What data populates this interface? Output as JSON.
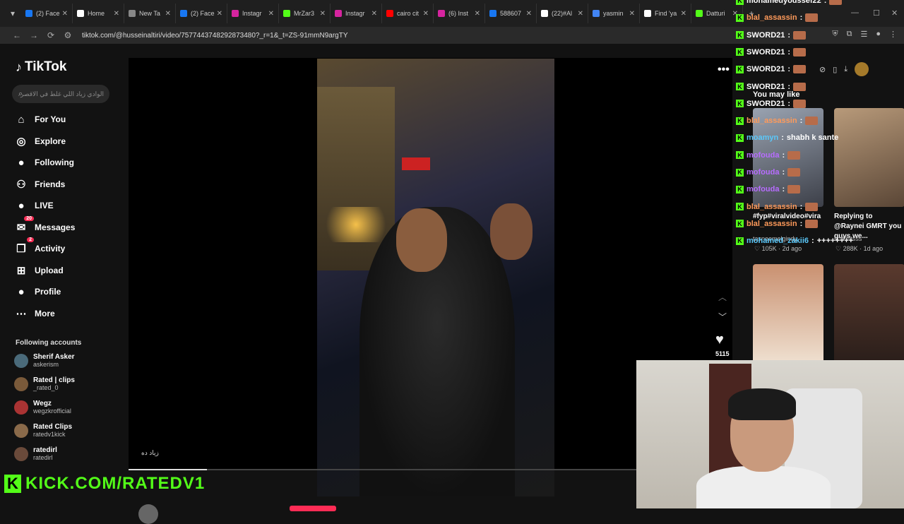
{
  "browser": {
    "tabs": [
      {
        "label": "(2) Face",
        "icon": "facebook-icon",
        "color": "#1877f2"
      },
      {
        "label": "Home",
        "icon": "x-icon",
        "color": "#ffffff"
      },
      {
        "label": "New Ta",
        "icon": "chrome-icon",
        "color": "#888888"
      },
      {
        "label": "(2) Face",
        "icon": "facebook-icon",
        "color": "#1877f2"
      },
      {
        "label": "Instagr",
        "icon": "instagram-icon",
        "color": "#d6249f"
      },
      {
        "label": "MrZar3",
        "icon": "kick-icon",
        "color": "#53fc18"
      },
      {
        "label": "Instagr",
        "icon": "instagram-icon",
        "color": "#d6249f"
      },
      {
        "label": "cairo cit",
        "icon": "youtube-icon",
        "color": "#ff0000"
      },
      {
        "label": "(6) Inst",
        "icon": "instagram-icon",
        "color": "#d6249f"
      },
      {
        "label": "588607",
        "icon": "facebook-icon",
        "color": "#1877f2"
      },
      {
        "label": "(22)#Al",
        "icon": "tiktok-icon",
        "color": "#ffffff"
      },
      {
        "label": "yasmin",
        "icon": "google-icon",
        "color": "#4285f4"
      },
      {
        "label": "Find 'ya",
        "icon": "tiktok-icon",
        "color": "#ffffff"
      },
      {
        "label": "Datturi",
        "icon": "kick-icon",
        "color": "#53fc18"
      }
    ],
    "url": "tiktok.com/@husseinaltiri/video/7577443748292873480?_r=1&_t=ZS-91mmN9argTY"
  },
  "sidebar": {
    "logo": "TikTok",
    "search_placeholder": "الوادي زياد اللي غلط في الاقصر",
    "nav": [
      {
        "label": "For You",
        "icon": "home-icon"
      },
      {
        "label": "Explore",
        "icon": "compass-icon"
      },
      {
        "label": "Following",
        "icon": "following-avatar-icon"
      },
      {
        "label": "Friends",
        "icon": "friends-icon"
      },
      {
        "label": "LIVE",
        "icon": "live-icon"
      },
      {
        "label": "Messages",
        "icon": "messages-icon",
        "badge": "20"
      },
      {
        "label": "Activity",
        "icon": "activity-icon",
        "badge": "2"
      },
      {
        "label": "Upload",
        "icon": "upload-icon"
      },
      {
        "label": "Profile",
        "icon": "profile-avatar-icon"
      },
      {
        "label": "More",
        "icon": "more-icon"
      }
    ],
    "following_title": "Following accounts",
    "accounts": [
      {
        "name": "Sherif Asker",
        "handle": "askerism"
      },
      {
        "name": "Rated | clips",
        "handle": "_rated_0"
      },
      {
        "name": "Wegz",
        "handle": "wegzkrofficial"
      },
      {
        "name": "Rated Clips",
        "handle": "ratedv1kick"
      },
      {
        "name": "ratedirl",
        "handle": "ratedirl"
      }
    ]
  },
  "overlay": {
    "kick_url": "KICK.COM/RATEDV1"
  },
  "player": {
    "caption": "زياد ده",
    "progress": 0.13,
    "like_count": "5115"
  },
  "recommend": {
    "title": "You may like",
    "items": [
      {
        "caption": "#fyp#viralvideo#vira",
        "sub": "tasneemelgindy",
        "views": "105K",
        "age": "2d ago"
      },
      {
        "caption": "Replying to @Raynei GMRT you guys we...",
        "sub": "soff.liftsss",
        "views": "288K",
        "age": "1d ago"
      }
    ]
  },
  "chat": [
    {
      "user": "mohamedyoussef22",
      "color": "#ffffff",
      "msg": ""
    },
    {
      "user": "blal_assassin",
      "color": "#ff9a5a",
      "msg": ""
    },
    {
      "user": "SWORD21",
      "color": "#ffffff",
      "msg": ""
    },
    {
      "user": "SWORD21",
      "color": "#ffffff",
      "msg": ""
    },
    {
      "user": "SWORD21",
      "color": "#ffffff",
      "msg": ""
    },
    {
      "user": "SWORD21",
      "color": "#ffffff",
      "msg": ""
    },
    {
      "user": "SWORD21",
      "color": "#ffffff",
      "msg": ""
    },
    {
      "user": "blal_assassin",
      "color": "#ff9a5a",
      "msg": ""
    },
    {
      "user": "moamyn",
      "color": "#5ac8fa",
      "msg": "shabh k sante"
    },
    {
      "user": "mofouda",
      "color": "#b76cff",
      "msg": ""
    },
    {
      "user": "mofouda",
      "color": "#b76cff",
      "msg": ""
    },
    {
      "user": "mofouda",
      "color": "#b76cff",
      "msg": ""
    },
    {
      "user": "blal_assassin",
      "color": "#ff9a5a",
      "msg": ""
    },
    {
      "user": "blal_assassin",
      "color": "#ff9a5a",
      "msg": ""
    },
    {
      "user": "mohamed_zakii6",
      "color": "#5ac8fa",
      "msg": "++++++++"
    }
  ]
}
